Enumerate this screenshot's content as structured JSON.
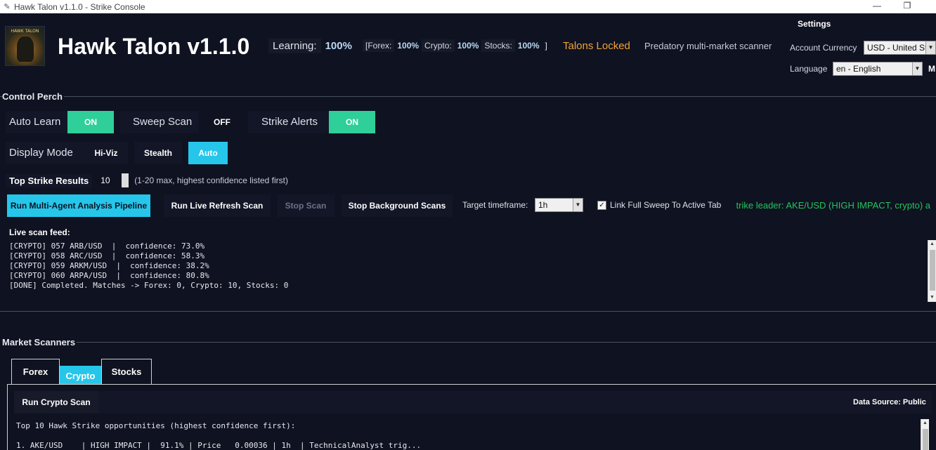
{
  "window": {
    "title": "Hawk Talon v1.1.0 - Strike Console",
    "minimize_glyph": "—",
    "maximize_glyph": "❐"
  },
  "header": {
    "logo_text": "HAWK TALON",
    "app_title": "Hawk Talon v1.1.0",
    "learning_label": "Learning:",
    "learning_value": "100%",
    "markets": {
      "open_bracket": "[Forex:",
      "forex_value": "100%",
      "crypto_label": "Crypto:",
      "crypto_value": "100%",
      "stocks_label": "Stocks:",
      "stocks_value": "100%",
      "close_bracket": "]"
    },
    "status": "Talons Locked",
    "tagline": "Predatory multi-market scanner"
  },
  "settings": {
    "title": "Settings",
    "currency_label": "Account Currency",
    "currency_value": "USD - United Stat",
    "language_label": "Language",
    "language_value": "en - English",
    "extra_label": "M"
  },
  "control_perch": {
    "title": "Control Perch",
    "auto_learn_label": "Auto Learn",
    "auto_learn_state": "ON",
    "sweep_scan_label": "Sweep Scan",
    "sweep_scan_state": "OFF",
    "strike_alerts_label": "Strike Alerts",
    "strike_alerts_state": "ON",
    "display_mode_label": "Display Mode",
    "display_modes": [
      "Hi-Viz",
      "Stealth",
      "Auto"
    ],
    "display_mode_active": "Auto",
    "top_results_label": "Top Strike Results",
    "top_results_value": "10",
    "top_results_hint": "(1-20 max, highest confidence listed first)",
    "buttons": {
      "run_pipeline": "Run Multi-Agent Analysis Pipeline",
      "live_refresh": "Run Live Refresh Scan",
      "stop_scan": "Stop Scan",
      "stop_background": "Stop Background Scans"
    },
    "timeframe_label": "Target timeframe:",
    "timeframe_value": "1h",
    "link_sweep_label": "Link Full Sweep To Active Tab",
    "link_sweep_checked": true,
    "leader_text": "Strike leader: AKE/USD (HIGH IMPACT, crypto) a",
    "feed_title": "Live scan feed:",
    "feed_lines": [
      "[CRYPTO] 057 ARB/USD  |  confidence: 73.0%",
      "[CRYPTO] 058 ARC/USD  |  confidence: 58.3%",
      "[CRYPTO] 059 ARKM/USD  |  confidence: 38.2%",
      "[CRYPTO] 060 ARPA/USD  |  confidence: 80.8%",
      "[DONE] Completed. Matches -> Forex: 0, Crypto: 10, Stocks: 0"
    ]
  },
  "market_scanners": {
    "title": "Market Scanners",
    "tabs": [
      "Forex",
      "Crypto",
      "Stocks"
    ],
    "active_tab": "Crypto",
    "run_button": "Run Crypto Scan",
    "data_source": "Data Source: Public",
    "results_header": "Top 10 Hawk Strike opportunities (highest confidence first):",
    "results_lines": [
      "1. AKE/USD    | HIGH IMPACT |  91.1% | Price   0.00036 | 1h  | TechnicalAnalyst trig..."
    ]
  },
  "colors": {
    "background": "#0f1220",
    "on_green": "#2ecf98",
    "active_cyan": "#26c6ea",
    "status_orange": "#f2a33a",
    "leader_green": "#22c55e",
    "value_blue": "#b8d8f2"
  },
  "icons": {
    "app_icon": "feather-icon",
    "spinbox": "spinbox-arrows-icon",
    "combo": "chevron-down-icon"
  }
}
